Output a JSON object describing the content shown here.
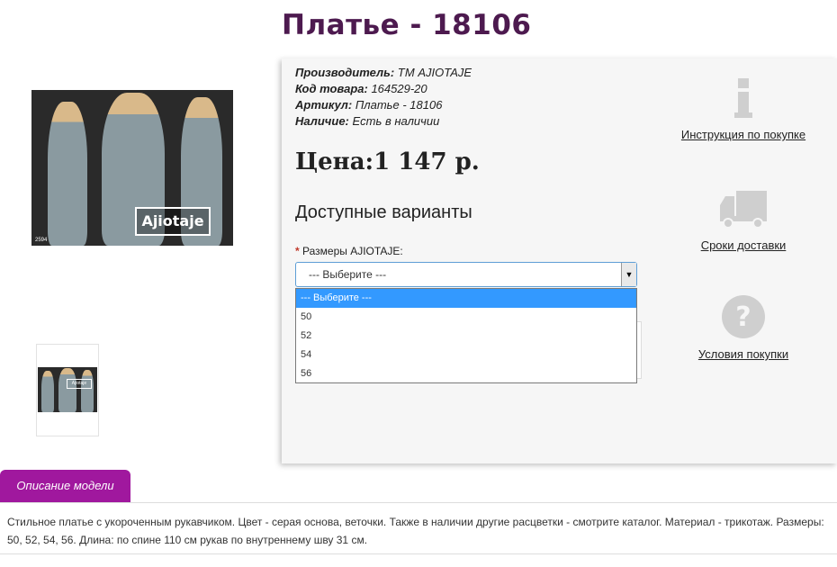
{
  "product": {
    "title": "Платье - 18106",
    "info": [
      {
        "label": "Производитель:",
        "value": "ТМ AJIOTAJE"
      },
      {
        "label": "Код товара:",
        "value": "164529-20"
      },
      {
        "label": "Артикул:",
        "value": "Платье - 18106"
      },
      {
        "label": "Наличие:",
        "value": "Есть в наличии"
      }
    ],
    "price": "Цена:1 147 р.",
    "variants_heading": "Доступные варианты",
    "image_logo": "Ajiotaje",
    "image_code": "2594",
    "thumb_logo": "Ajiotaje"
  },
  "size_select": {
    "required_mark": "*",
    "label": "Размеры AJIOTAJE:",
    "selected": "--- Выберите ---",
    "options": [
      "--- Выберите ---",
      "50",
      "52",
      "54",
      "56"
    ]
  },
  "sidebar_links": {
    "instructions": "Инструкция по покупке",
    "delivery": "Сроки доставки",
    "conditions": "Условия покупки"
  },
  "tabs": {
    "description": "Описание модели"
  },
  "description": "Стильное платье с укороченным рукавчиком. Цвет - серая основа, веточки. Также в наличии другие расцветки - смотрите каталог. Материал - трикотаж. Размеры: 50, 52, 54, 56. Длина: по спине 110 см рукав по внутреннему шву 31 см.",
  "colors": {
    "title": "#4d1a4f",
    "tab": "#a0189e",
    "highlight": "#3399ff",
    "icon_gray": "#cfcfcf"
  }
}
